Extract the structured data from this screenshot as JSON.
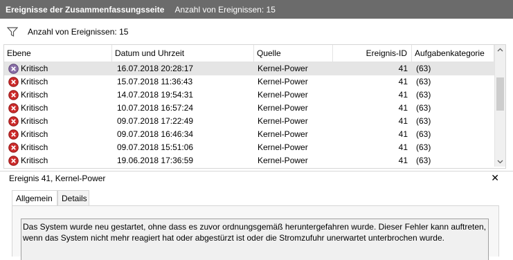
{
  "title": {
    "name": "Ereignisse der Zusammenfassungsseite",
    "count_text": "Anzahl von Ereignissen: 15"
  },
  "filter": {
    "icon": "filter-icon",
    "text": "Anzahl von Ereignissen: 15"
  },
  "columns": {
    "level": "Ebene",
    "datetime": "Datum und Uhrzeit",
    "source": "Quelle",
    "event_id": "Ereignis-ID",
    "task_category": "Aufgabenkategorie"
  },
  "events": [
    {
      "level": "Kritisch",
      "datetime": "16.07.2018 20:28:17",
      "source": "Kernel-Power",
      "event_id": "41",
      "task_category": "(63)",
      "selected": true
    },
    {
      "level": "Kritisch",
      "datetime": "15.07.2018 11:36:43",
      "source": "Kernel-Power",
      "event_id": "41",
      "task_category": "(63)"
    },
    {
      "level": "Kritisch",
      "datetime": "14.07.2018 19:54:31",
      "source": "Kernel-Power",
      "event_id": "41",
      "task_category": "(63)"
    },
    {
      "level": "Kritisch",
      "datetime": "10.07.2018 16:57:24",
      "source": "Kernel-Power",
      "event_id": "41",
      "task_category": "(63)"
    },
    {
      "level": "Kritisch",
      "datetime": "09.07.2018 17:22:49",
      "source": "Kernel-Power",
      "event_id": "41",
      "task_category": "(63)"
    },
    {
      "level": "Kritisch",
      "datetime": "09.07.2018 16:46:34",
      "source": "Kernel-Power",
      "event_id": "41",
      "task_category": "(63)"
    },
    {
      "level": "Kritisch",
      "datetime": "09.07.2018 15:51:06",
      "source": "Kernel-Power",
      "event_id": "41",
      "task_category": "(63)"
    },
    {
      "level": "Kritisch",
      "datetime": "19.06.2018 17:36:59",
      "source": "Kernel-Power",
      "event_id": "41",
      "task_category": "(63)"
    }
  ],
  "detail": {
    "title": "Ereignis 41, Kernel-Power",
    "close_icon": "close-icon",
    "tabs": [
      "Allgemein",
      "Details"
    ],
    "description": "Das System wurde neu gestartet, ohne dass es zuvor ordnungsgemäß heruntergefahren wurde. Dieser Fehler kann auftreten, wenn das System nicht mehr reagiert hat oder abgestürzt ist oder die Stromzufuhr unerwartet unterbrochen wurde."
  },
  "colors": {
    "titlebar_bg": "#6b6b6b",
    "selected_row_bg": "#e5e5e5",
    "critical_icon": "#cc2b2b",
    "critical_icon_selected": "#8a6fa8"
  }
}
